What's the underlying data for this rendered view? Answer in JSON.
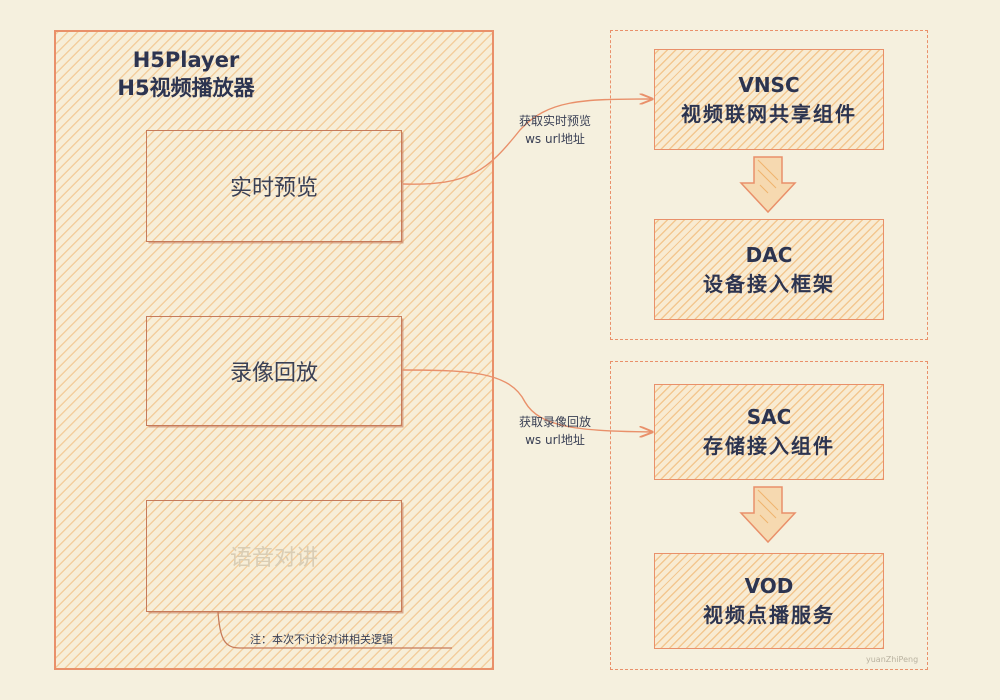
{
  "player": {
    "title_en": "H5Player",
    "title_zh": "H5视频播放器",
    "features": [
      {
        "label": "实时预览"
      },
      {
        "label": "录像回放"
      },
      {
        "label": "语音对讲"
      }
    ],
    "note": "注：本次不讨论对讲相关逻辑"
  },
  "groups": [
    {
      "components": [
        {
          "name": "VNSC",
          "desc": "视频联网共享组件"
        },
        {
          "name": "DAC",
          "desc": "设备接入框架"
        }
      ]
    },
    {
      "components": [
        {
          "name": "SAC",
          "desc": "存储接入组件"
        },
        {
          "name": "VOD",
          "desc": "视频点播服务"
        }
      ]
    }
  ],
  "edges": [
    {
      "line1": "获取实时预览",
      "line2": "ws url地址"
    },
    {
      "line1": "获取录像回放",
      "line2": "ws url地址"
    }
  ],
  "watermark": "yuanZhiPeng",
  "colors": {
    "background": "#f5f0de",
    "accent_stroke": "#e9906a",
    "hatch": "#f0b46e",
    "text": "#2c3450",
    "muted_text": "#d9cdb5"
  }
}
